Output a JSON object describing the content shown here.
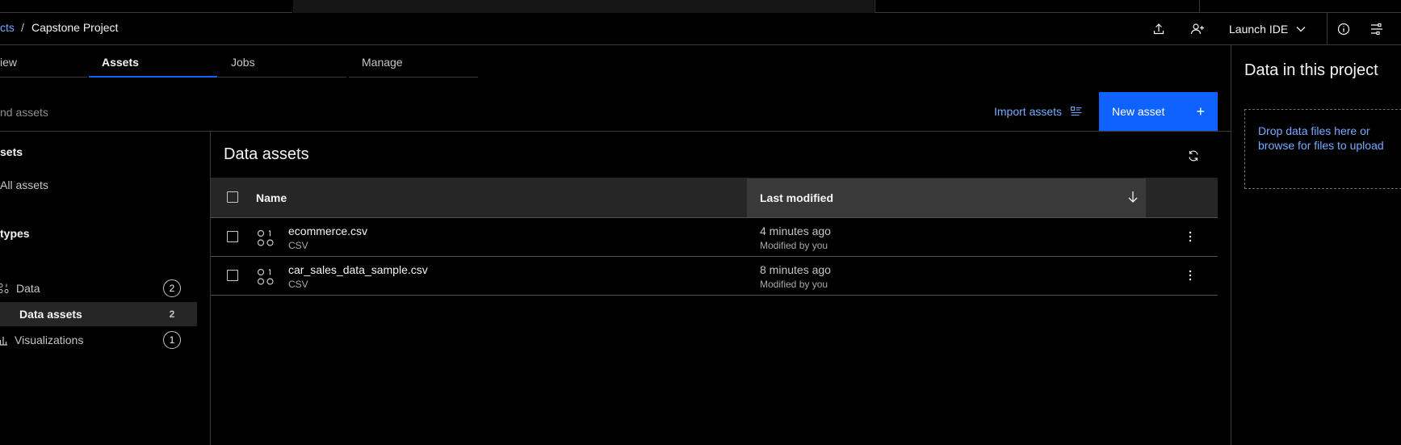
{
  "breadcrumb": {
    "parent": "cts",
    "separator": "/",
    "current": "Capstone Project"
  },
  "header": {
    "launch_ide": "Launch IDE",
    "icons": [
      "upload-icon",
      "add-collaborator-icon",
      "chevron-down-icon",
      "info-icon",
      "manage-panel-icon"
    ]
  },
  "tabs": [
    {
      "label": "iew",
      "active": false
    },
    {
      "label": "Assets",
      "active": true
    },
    {
      "label": "Jobs",
      "active": false
    },
    {
      "label": "Manage",
      "active": false
    }
  ],
  "toolbar": {
    "search_placeholder": "nd assets",
    "import_label": "Import assets",
    "new_asset_label": "New asset",
    "new_asset_icon": "+"
  },
  "sidebar": {
    "assets_heading": "sets",
    "all_assets": "All assets",
    "types_heading": "types",
    "items": [
      {
        "label": "Data",
        "count": "2",
        "icon": "data-icon"
      },
      {
        "label": "Data assets",
        "count": "2",
        "selected": true
      },
      {
        "label": "Visualizations",
        "count": "1",
        "icon": "chart-icon"
      }
    ]
  },
  "main": {
    "title": "Data assets",
    "columns": {
      "name": "Name",
      "modified": "Last modified"
    },
    "rows": [
      {
        "name": "ecommerce.csv",
        "type": "CSV",
        "time": "4 minutes ago",
        "by": "Modified by you"
      },
      {
        "name": "car_sales_data_sample.csv",
        "type": "CSV",
        "time": "8 minutes ago",
        "by": "Modified by you"
      }
    ]
  },
  "right_panel": {
    "title": "Data in this project",
    "drop_line1": "Drop data files here or",
    "drop_line2": "browse for files to upload"
  },
  "colors": {
    "accent": "#0f62fe",
    "link": "#78a9ff",
    "background": "#000000"
  }
}
